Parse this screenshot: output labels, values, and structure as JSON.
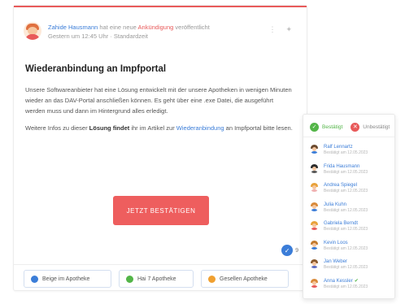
{
  "post": {
    "author": "Zahide Hausmann",
    "meta_mid": "hat eine neue",
    "tag": "Ankündigung",
    "meta_tail": "veröffentlicht",
    "meta_line2": "Gestern um 12:45 Uhr · Standardzeit",
    "title": "Wiederanbindung an Impfportal",
    "p1": "Unsere Softwareanbieter hat eine Lösung entwickelt mit der unsere Apotheken in wenigen Minuten wieder an das DAV-Portal anschließen können. Es geht über eine .exe Datei, die ausgeführt werden muss und dann im Hintergrund alles erledigt.",
    "p2_pre": "Weitere Infos zu dieser",
    "p2_bold": "Lösung findet",
    "p2_mid": "ihr im Artikel zur",
    "p2_link": "Wiederanbindung",
    "p2_post": "an Impfportal bitte lesen.",
    "confirm_label": "JETZT BESTÄTIGEN",
    "reaction_count": "9"
  },
  "footer": {
    "btn1": "Beige im Apotheke",
    "btn2": "Hai 7 Apotheke",
    "btn3": "Gesellen Apotheke"
  },
  "colors": {
    "accent": "#e85a5a",
    "link": "#3b7dd8",
    "confirmed": "#53b548"
  },
  "panel": {
    "tab_yes": "Bestätigt",
    "tab_no": "Unbestätigt",
    "people": [
      {
        "name": "Ralf Lennartz",
        "sub": "Bestätigt am 12.05.2023",
        "hair": "#6b4a2e",
        "shirt": "#3b7dd8",
        "check": ""
      },
      {
        "name": "Frida Hausmann",
        "sub": "Bestätigt am 12.05.2023",
        "hair": "#2b2b2b",
        "shirt": "#555555",
        "check": ""
      },
      {
        "name": "Andrea Spiegel",
        "sub": "Bestätigt am 12.05.2023",
        "hair": "#e8a23a",
        "shirt": "#f0b0b0",
        "check": ""
      },
      {
        "name": "Julia Kuhn",
        "sub": "Bestätigt am 12.05.2023",
        "hair": "#d98a3a",
        "shirt": "#3b7dd8",
        "check": ""
      },
      {
        "name": "Gabriela Berndt",
        "sub": "Bestätigt am 12.05.2023",
        "hair": "#e8a23a",
        "shirt": "#e85a5a",
        "check": ""
      },
      {
        "name": "Kevin Loos",
        "sub": "Bestätigt am 12.05.2023",
        "hair": "#c27a2e",
        "shirt": "#3b7dd8",
        "check": ""
      },
      {
        "name": "Jan Weber",
        "sub": "Bestätigt am 12.05.2023",
        "hair": "#8a5a2e",
        "shirt": "#5c6bc0",
        "check": ""
      },
      {
        "name": "Anna Kessler",
        "sub": "Bestätigt am 12.05.2023",
        "hair": "#d98a3a",
        "shirt": "#e85a5a",
        "check": "✔"
      }
    ]
  }
}
